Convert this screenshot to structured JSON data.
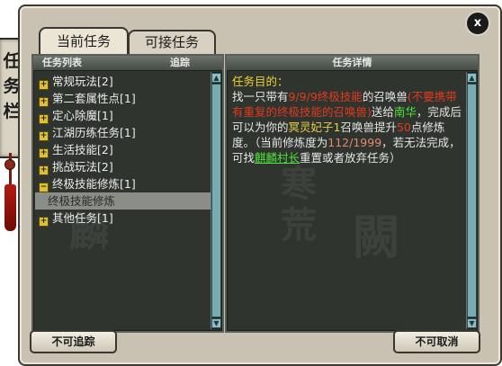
{
  "plaque": {
    "title_chars": [
      "任",
      "务",
      "栏"
    ]
  },
  "close": {
    "label": "x"
  },
  "tabs": {
    "current": "当前任务",
    "available": "可接任务"
  },
  "left_panel": {
    "header_title": "任务列表",
    "header_track": "追踪",
    "items": [
      {
        "marker": "+",
        "label": "常规玩法[2]"
      },
      {
        "marker": "+",
        "label": "第二套属性点[1]"
      },
      {
        "marker": "+",
        "label": "定心除魔[1]"
      },
      {
        "marker": "+",
        "label": "江湖历练任务[1]"
      },
      {
        "marker": "+",
        "label": "生活技能[2]"
      },
      {
        "marker": "+",
        "label": "挑战玩法[2]"
      },
      {
        "marker": "−",
        "label": "终极技能修炼[1]"
      },
      {
        "marker": "",
        "label": "终极技能修炼"
      },
      {
        "marker": "+",
        "label": "其他任务[1]"
      }
    ],
    "selected_index": 7
  },
  "right_panel": {
    "header_title": "任务详情",
    "purpose_label": "任务目的：",
    "t1": "找一只带有",
    "t2": "9/9/9终极技能",
    "t3": "的召唤兽",
    "t4": "(不要携带有重复的终极技能的召唤兽)",
    "t5": "送给",
    "npc1": "南华",
    "t6": "，完成后可以为你的",
    "pet": "冥灵妃子1",
    "t7": "召唤兽提升",
    "pts": "50",
    "t8": "点修炼度。（当前修炼度为",
    "progress": "112/1999",
    "t9": "，若无法完成，可找",
    "npc2": "麒麟村长",
    "t10": "重置或者放弃任务）"
  },
  "buttons": {
    "untrackable": "不可追踪",
    "uncancelable": "不可取消"
  },
  "colors": {
    "panel_bg": "#2f342f",
    "frame_bg": "#c9c1b2",
    "highlight_yellow": "#f0d232",
    "highlight_red": "#e23a1e",
    "highlight_green": "#4ee23a"
  }
}
